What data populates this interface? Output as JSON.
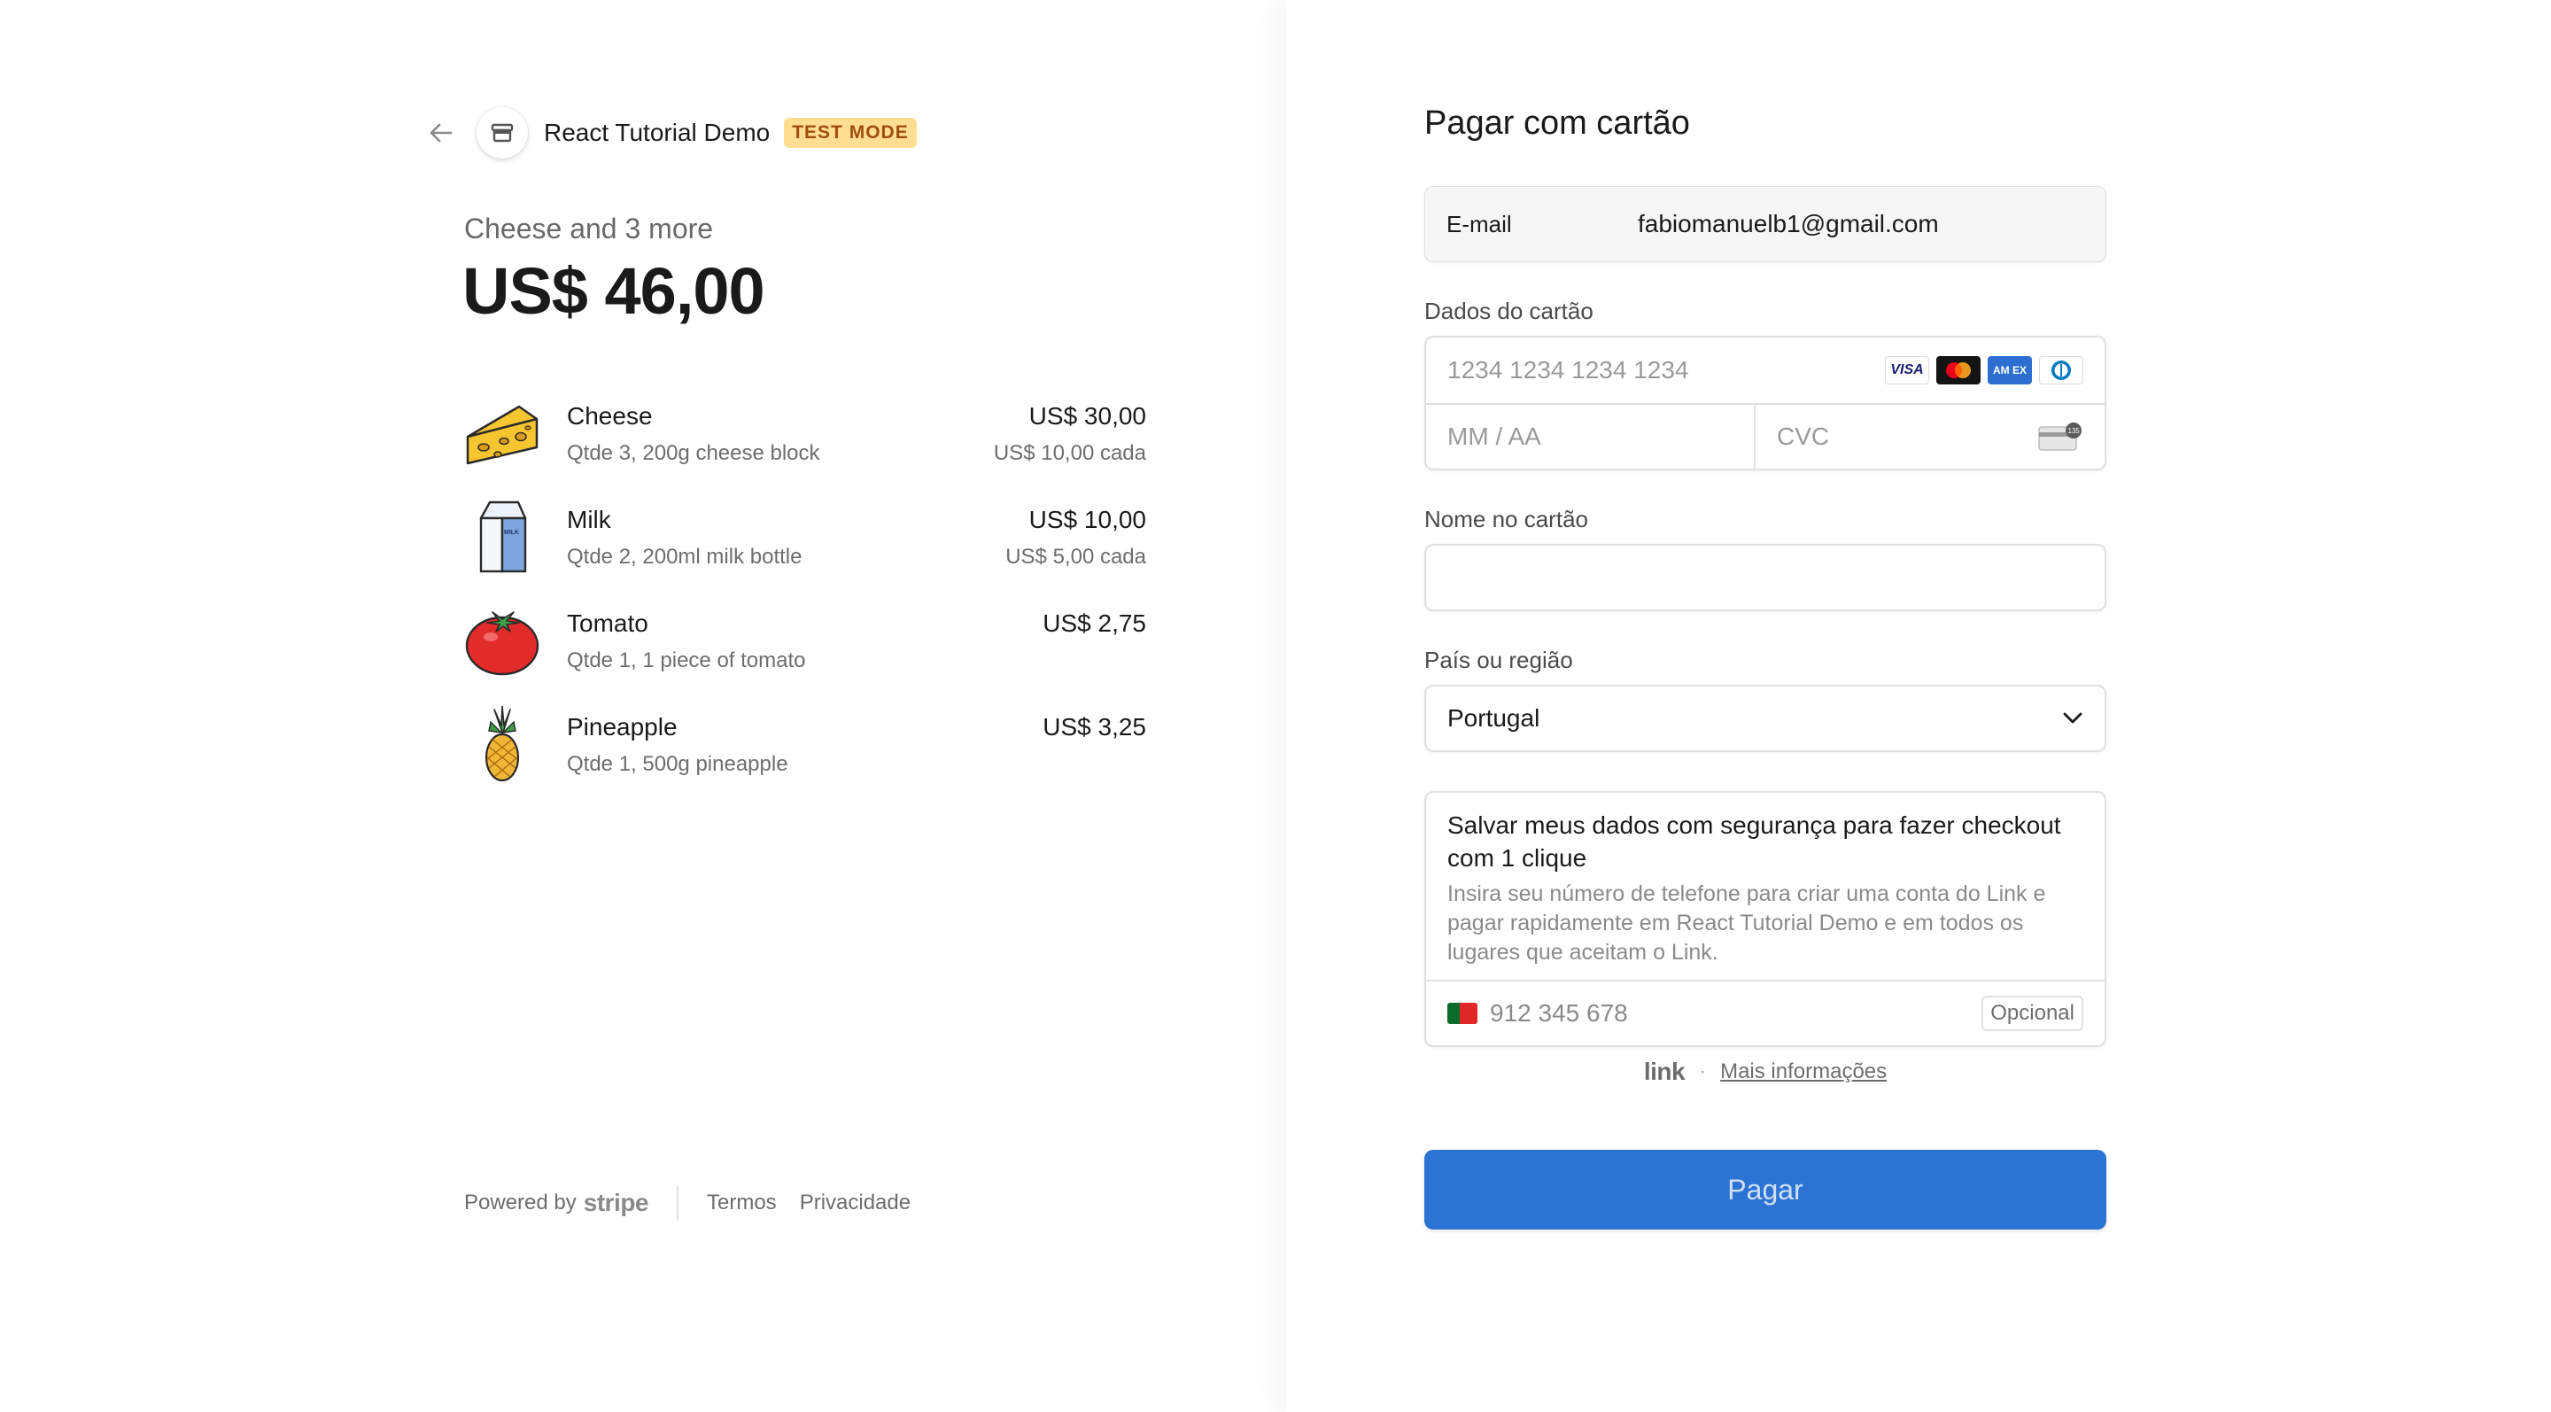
{
  "merchant": {
    "name": "React Tutorial Demo",
    "test_badge": "TEST MODE"
  },
  "summary": {
    "title": "Cheese and 3 more",
    "total": "US$ 46,00"
  },
  "items": [
    {
      "name": "Cheese",
      "desc": "Qtde 3, 200g cheese block",
      "price": "US$ 30,00",
      "unit": "US$ 10,00 cada",
      "icon": "cheese-icon"
    },
    {
      "name": "Milk",
      "desc": "Qtde 2, 200ml milk bottle",
      "price": "US$ 10,00",
      "unit": "US$ 5,00 cada",
      "icon": "milk-icon",
      "icon_text": "MILK"
    },
    {
      "name": "Tomato",
      "desc": "Qtde 1, 1 piece of tomato",
      "price": "US$ 2,75",
      "unit": "",
      "icon": "tomato-icon"
    },
    {
      "name": "Pineapple",
      "desc": "Qtde 1, 500g pineapple",
      "price": "US$ 3,25",
      "unit": "",
      "icon": "pineapple-icon"
    }
  ],
  "footer": {
    "powered_by": "Powered by",
    "stripe": "stripe",
    "terms": "Termos",
    "privacy": "Privacidade"
  },
  "form": {
    "title": "Pagar com cartão",
    "email_label": "E-mail",
    "email_value": "fabiomanuelb1@gmail.com",
    "card_label": "Dados do cartão",
    "card_number_placeholder": "1234 1234 1234 1234",
    "card_brands": [
      "VISA",
      "mastercard",
      "AMEX",
      "diners"
    ],
    "brand_labels": {
      "visa": "VISA",
      "amex": "AM EX"
    },
    "expiry_placeholder": "MM / AA",
    "cvc_placeholder": "CVC",
    "cvc_icon_text": "135",
    "name_label": "Nome no cartão",
    "name_value": "",
    "country_label": "País ou região",
    "country_value": "Portugal",
    "link": {
      "title": "Salvar meus dados com segurança para fazer checkout com 1 clique",
      "description": "Insira seu número de telefone para criar uma conta do Link e pagar rapidamente em React Tutorial Demo e em todos os lugares que aceitam o Link.",
      "phone_placeholder": "912 345 678",
      "optional": "Opcional",
      "logo": "link",
      "separator": "·",
      "more_info": "Mais informações"
    },
    "pay_button": "Pagar"
  },
  "colors": {
    "pay_button": "#2c74d3",
    "test_badge_bg": "#ffde92",
    "test_badge_text": "#a04e0e"
  }
}
